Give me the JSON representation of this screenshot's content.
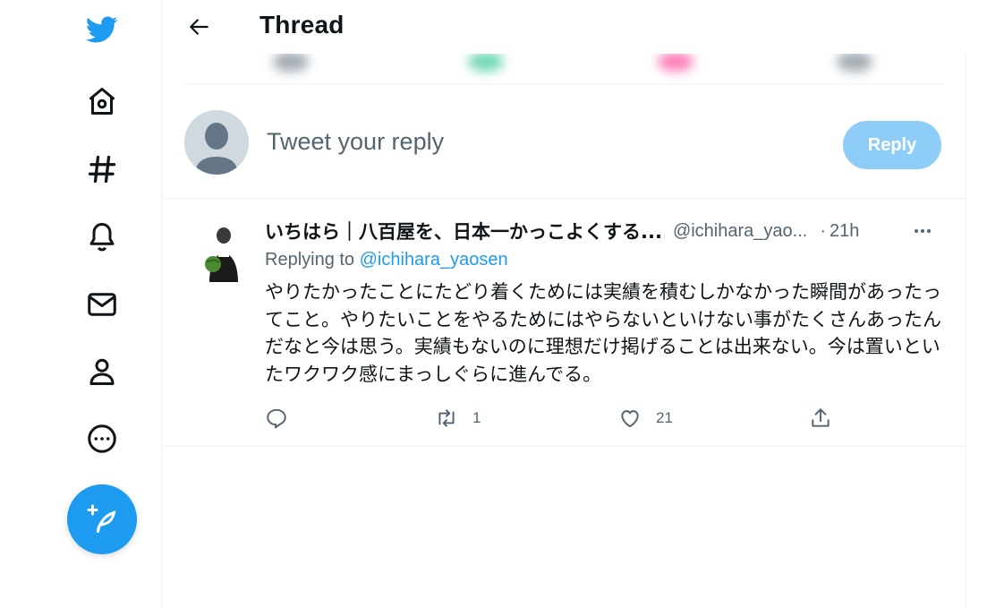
{
  "nav": {
    "items": [
      {
        "name": "twitter-logo-icon"
      },
      {
        "name": "home-icon"
      },
      {
        "name": "explore-hashtag-icon"
      },
      {
        "name": "notifications-bell-icon"
      },
      {
        "name": "messages-envelope-icon"
      },
      {
        "name": "profile-person-icon"
      },
      {
        "name": "more-circle-icon"
      }
    ],
    "compose_icon": "feather-plus-icon"
  },
  "header": {
    "title": "Thread",
    "back_icon": "arrow-left-icon"
  },
  "reply_box": {
    "placeholder": "Tweet your reply",
    "button_label": "Reply"
  },
  "tweet": {
    "display_name": "いちはら｜八百屋を、日本一かっこよくする...",
    "handle": "@ichihara_yao...",
    "separator": "·",
    "time": "21h",
    "replying_prefix": "Replying to",
    "replying_to": "@ichihara_yaosen",
    "text": "やりたかったことにたどり着くためには実績を積むしかなかった瞬間があったってこと。やりたいことをやるためにはやらないといけない事がたくさんあったんだなと今は思う。実績もないのに理想だけ掲げることは出来ない。今は置いといたワクワク感にまっしぐらに進んでる。",
    "actions": {
      "reply_count": "",
      "retweet_count": "1",
      "like_count": "21"
    }
  },
  "colors": {
    "accent": "#1d9bf0",
    "reply_button_disabled": "#8ecdf8",
    "text_primary": "#0f1419",
    "text_secondary": "#536471",
    "border": "#eff3f4"
  }
}
